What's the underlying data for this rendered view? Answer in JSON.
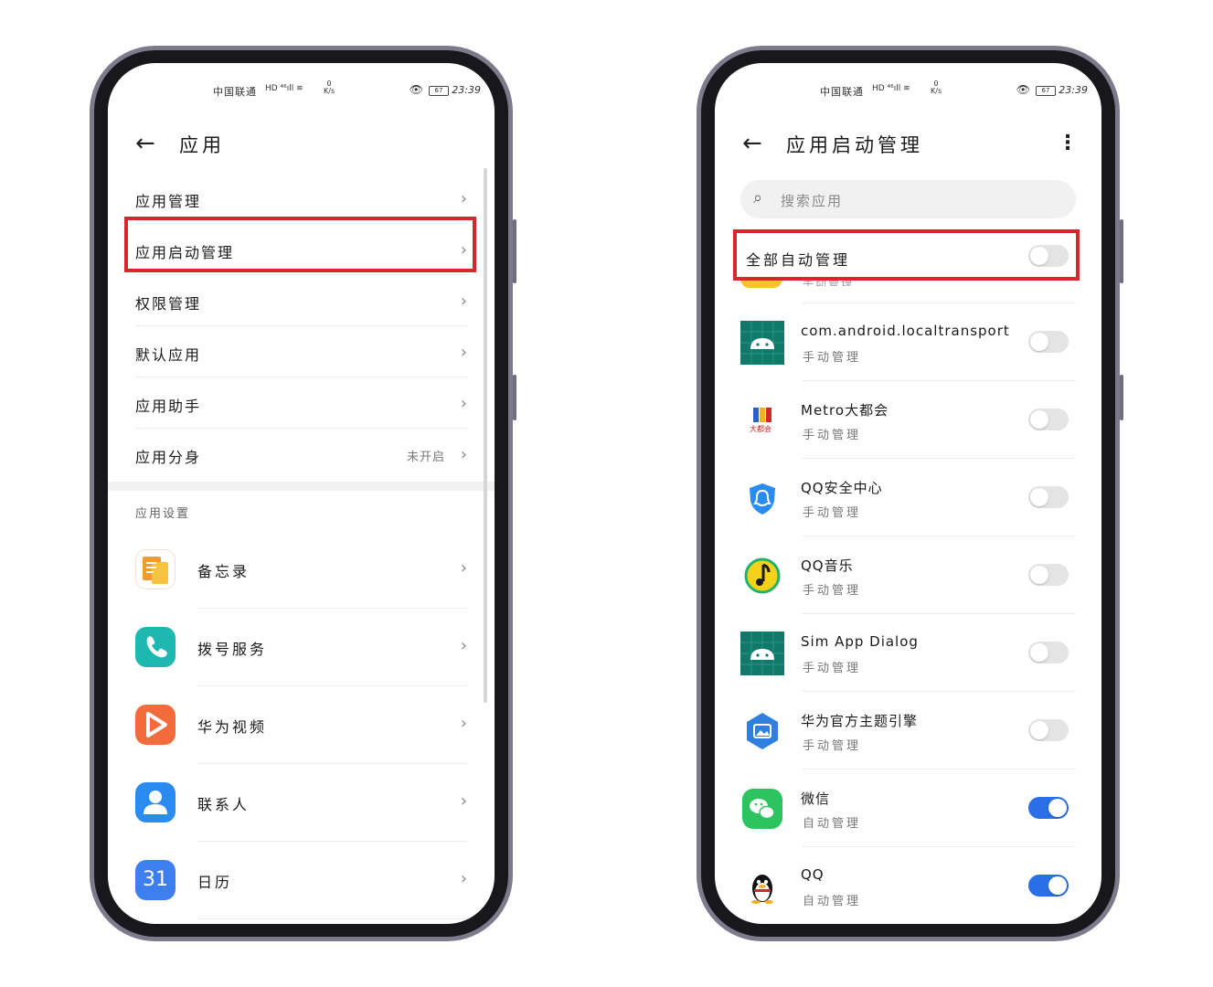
{
  "status_bar": {
    "carrier": "中国联通",
    "network": "HD ⁴⁶ıll ≋",
    "speed_value": "0",
    "speed_unit": "K/s",
    "battery": "67",
    "time": "23:39"
  },
  "left_screen": {
    "title": "应用",
    "menu": [
      {
        "label": "应用管理",
        "value": ""
      },
      {
        "label": "应用启动管理",
        "value": ""
      },
      {
        "label": "权限管理",
        "value": ""
      },
      {
        "label": "默认应用",
        "value": ""
      },
      {
        "label": "应用助手",
        "value": ""
      },
      {
        "label": "应用分身",
        "value": "未开启"
      }
    ],
    "section_title": "应用设置",
    "apps": [
      {
        "label": "备忘录",
        "icon": "memo-icon",
        "color": "#f39a2e"
      },
      {
        "label": "拨号服务",
        "icon": "phone-icon",
        "color": "#1fb8b0"
      },
      {
        "label": "华为视频",
        "icon": "video-play-icon",
        "color": "#f36b3a"
      },
      {
        "label": "联系人",
        "icon": "contact-icon",
        "color": "#2a8cf0"
      },
      {
        "label": "日历",
        "icon": "calendar-icon",
        "color": "#3e7ff0",
        "icon_text": "31"
      }
    ]
  },
  "right_screen": {
    "title": "应用启动管理",
    "search_placeholder": "搜索应用",
    "all_label": "全部自动管理",
    "all_enabled": false,
    "partial_sub": "手动管理",
    "apps": [
      {
        "name": "com.android.localtransport",
        "sub": "手动管理",
        "icon": "android-icon",
        "enabled": false
      },
      {
        "name": "Metro大都会",
        "sub": "手动管理",
        "icon": "metro-icon",
        "icon_text": "大都会",
        "enabled": false
      },
      {
        "name": "QQ安全中心",
        "sub": "手动管理",
        "icon": "shield-icon",
        "enabled": false
      },
      {
        "name": "QQ音乐",
        "sub": "手动管理",
        "icon": "music-icon",
        "enabled": false
      },
      {
        "name": "Sim App Dialog",
        "sub": "手动管理",
        "icon": "android-icon",
        "enabled": false
      },
      {
        "name": "华为官方主题引擎",
        "sub": "手动管理",
        "icon": "theme-icon",
        "enabled": false
      },
      {
        "name": "微信",
        "sub": "自动管理",
        "icon": "wechat-icon",
        "enabled": true
      },
      {
        "name": "QQ",
        "sub": "自动管理",
        "icon": "qq-penguin-icon",
        "enabled": true
      }
    ]
  },
  "colors": {
    "highlight": "#d9262c",
    "toggle_on": "#2a6ee8",
    "toggle_off": "#e4e4e4"
  }
}
